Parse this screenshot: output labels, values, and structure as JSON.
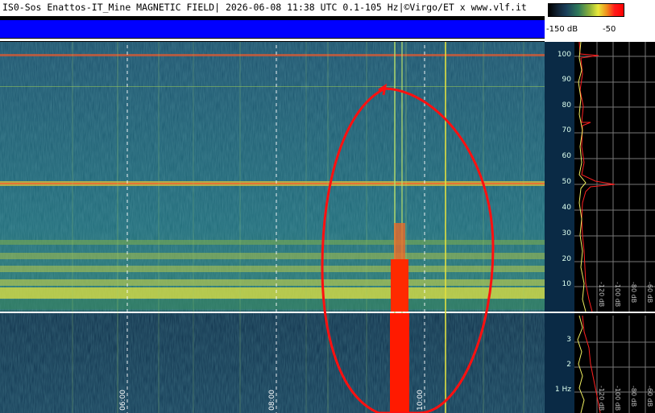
{
  "header": {
    "title": "IS0-Sos Enattos-IT_Mine MAGNETIC FIELD| 2026-06-08 11:38 UTC 0.1-105 Hz|©Virgo/ET x www.vlf.it"
  },
  "color_scale": {
    "min_label": "-150 dB",
    "max_label": "-50",
    "gradient": [
      "#000000",
      "#1a3f5a",
      "#2f7a5a",
      "#e9e93a",
      "#ff0000"
    ]
  },
  "spectrogram": {
    "time_labels": [
      "06:00",
      "08:00",
      "10:00"
    ],
    "background_color": "#1e5a6a",
    "upper_freq_labels": [
      "100",
      "90",
      "80",
      "70",
      "60",
      "50",
      "40",
      "30",
      "20",
      "10"
    ],
    "lower_freq_labels": [
      "3",
      "2",
      "1 Hz"
    ],
    "annotation_color": "#ff0000"
  },
  "spectrum_panel": {
    "db_labels_upper": [
      "-120 dB",
      "-100 dB",
      "-80 dB",
      "-60 dB",
      "-40 dB"
    ],
    "db_labels_lower": [
      "-120 dB",
      "-100 dB",
      "-80 dB",
      "-60 dB",
      "-40 dB"
    ]
  }
}
